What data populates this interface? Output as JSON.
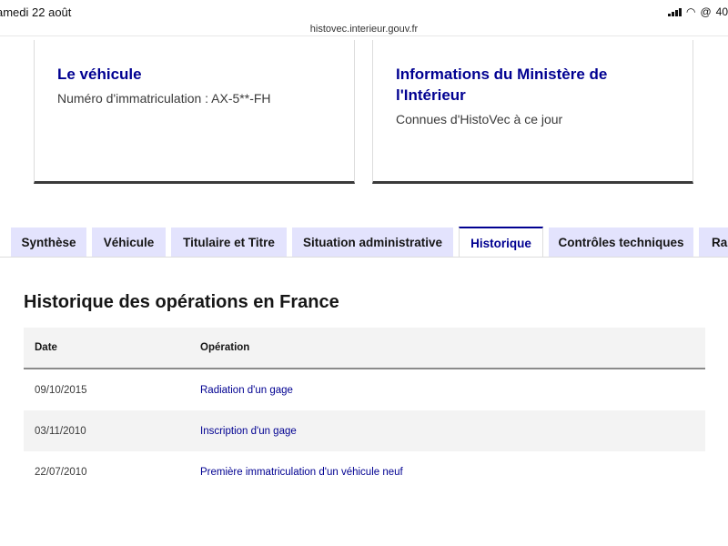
{
  "status_bar": {
    "time": "amedi 22 août",
    "battery": "40"
  },
  "url_bar": {
    "url": "histovec.interieur.gouv.fr"
  },
  "cards": [
    {
      "title": "Le véhicule",
      "description": "Numéro d'immatriculation : AX-5**-FH"
    },
    {
      "title": "Informations du Ministère de l'Intérieur",
      "description": "Connues d'HistoVec à ce jour"
    }
  ],
  "tabs": [
    {
      "label": "Synthèse"
    },
    {
      "label": "Véhicule"
    },
    {
      "label": "Titulaire et Titre"
    },
    {
      "label": "Situation administrative"
    },
    {
      "label": "Historique",
      "active": true
    },
    {
      "label": "Contrôles techniques"
    },
    {
      "label": "Rap"
    }
  ],
  "section": {
    "title": "Historique des opérations en France"
  },
  "table": {
    "headers": [
      "Date",
      "Opération"
    ],
    "rows": [
      {
        "date": "09/10/2015",
        "operation": "Radiation d'un gage"
      },
      {
        "date": "03/11/2010",
        "operation": "Inscription d'un gage"
      },
      {
        "date": "22/07/2010",
        "operation": "Première immatriculation d'un véhicule neuf"
      }
    ]
  },
  "colors": {
    "accent": "#000091",
    "tab_background": "#e3e3fd",
    "row_alt": "#f3f3f3"
  }
}
